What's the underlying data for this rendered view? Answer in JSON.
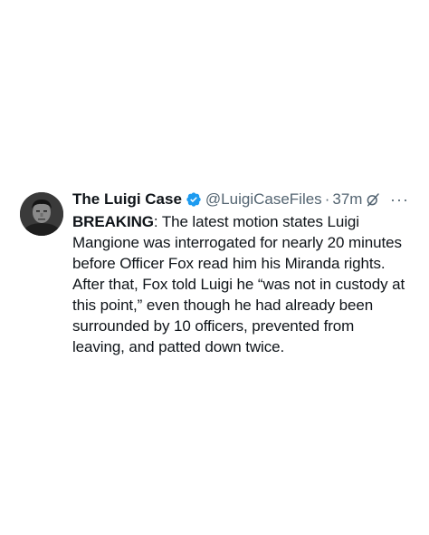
{
  "tweet": {
    "display_name": "The Luigi Case",
    "handle": "@LuigiCaseFiles",
    "separator": "·",
    "time": "37m",
    "body_bold": "BREAKING",
    "body_rest": ": The latest motion states Luigi Mangione was interrogated for nearly 20 minutes before Officer Fox read him his Miranda rights. After that, Fox told Luigi he “was not in custody at this point,” even though he had already been surrounded by 10 officers, prevented from leaving, and patted down twice.",
    "more_label": "···"
  },
  "colors": {
    "text": "#0f1419",
    "secondary": "#536471",
    "verified": "#1d9bf0"
  },
  "icons": {
    "verified": "verified-badge-icon",
    "grok": "grok-icon",
    "more": "more-icon"
  }
}
